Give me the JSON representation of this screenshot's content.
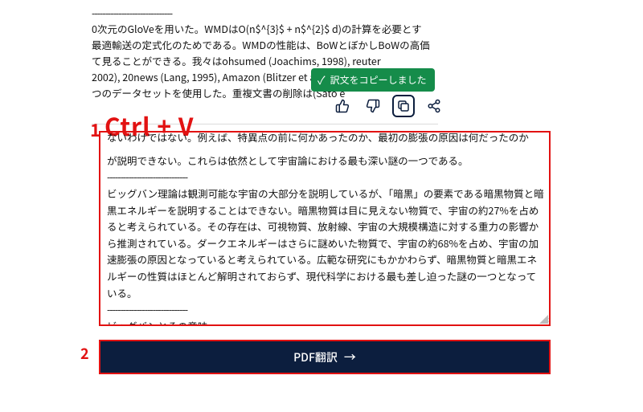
{
  "top_text": {
    "dash_line": "------------------------------",
    "line1": "0次元のGloVeを用いた。WMDはO(n$^{3}$ + n$^{2}$ d)の計算を必要とす",
    "line2": "最適輸送の定式化のためである。WMDの性能は、BoWとぼかしBoWの高価",
    "line3": "て見ることができる。我々はohsumed (Joachims, 1998), reuter",
    "line4": "2002), 20news (Lang, 1995), Amazon (Blitzer et al., 2007), classic",
    "line5": "つのデータセットを使用した。重複文書の削除は(Sato e"
  },
  "copy_notice": {
    "text": "訳文をコピーしました"
  },
  "annotations": {
    "num1": "1",
    "ctrlv": "Ctrl + V",
    "num2": "2"
  },
  "textarea": {
    "truncated_first": "ないわけではない。例えば、特異点の前に何かあったのか、最初の膨張の原因は何だったのか",
    "para1_rest": "が説明できない。これらは依然として宇宙論における最も深い謎の一つである。",
    "sep": "------------------------------",
    "para2": "ビッグバン理論は観測可能な宇宙の大部分を説明しているが、「暗黒」の要素である暗黒物質と暗黒エネルギーを説明することはできない。暗黒物質は目に見えない物質で、宇宙の約27%を占めると考えられている。その存在は、可視物質、放射線、宇宙の大規模構造に対する重力の影響から推測されている。ダークエネルギーはさらに謎めいた物質で、宇宙の約68%を占め、宇宙の加速膨張の原因となっていると考えられている。広範な研究にもかかわらず、暗黒物質と暗黒エネルギーの性質はほとんど解明されておらず、現代科学における最も差し迫った謎の一つとなっている。",
    "heading": "ビッグバンとその意味"
  },
  "buttons": {
    "pdf_translate": "PDF翻訳"
  }
}
